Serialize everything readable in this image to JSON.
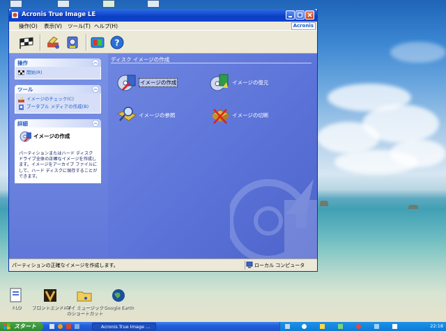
{
  "window": {
    "title": "Acronis True Image LE",
    "brand": "Acronis",
    "menu": [
      "操作(O)",
      "表示(V)",
      "ツール(T)",
      "ヘルプ(H)"
    ]
  },
  "task_pane": {
    "operations": {
      "title": "操作",
      "items": [
        "開始(R)"
      ]
    },
    "tools": {
      "title": "ツール",
      "items": [
        "イメージのチェック(C)",
        "ブータブル メディアの作成(B)"
      ]
    },
    "details": {
      "title": "詳細",
      "heading": "イメージの作成",
      "text": "パーティションまたはハード ディスク ドライブ全体の正確なイメージを作成します。イメージをアーカイブ ファイルにして、ハード ディスクに保存することができます。"
    }
  },
  "main": {
    "section_title": "ディスク イメージの作成",
    "actions": [
      "イメージの作成",
      "イメージの復元",
      "イメージの参照",
      "イメージの切断"
    ]
  },
  "status": {
    "left": "パーティションの正確なイメージを作成します。",
    "right": "ローカル コンピュータ"
  },
  "desktop": {
    "icons": [
      "Y-LO",
      "フロントエンドMV",
      "マイ ミュージック のショートカット",
      "Google Earth"
    ]
  },
  "taskbar": {
    "start_label": "スタート",
    "window_button": "Acronis True Image ...",
    "clock": "22:18"
  },
  "colors": {
    "task_pane_blue": "#6077d9",
    "title_blue": "#0a3fc2",
    "link_blue": "#215dc6"
  }
}
